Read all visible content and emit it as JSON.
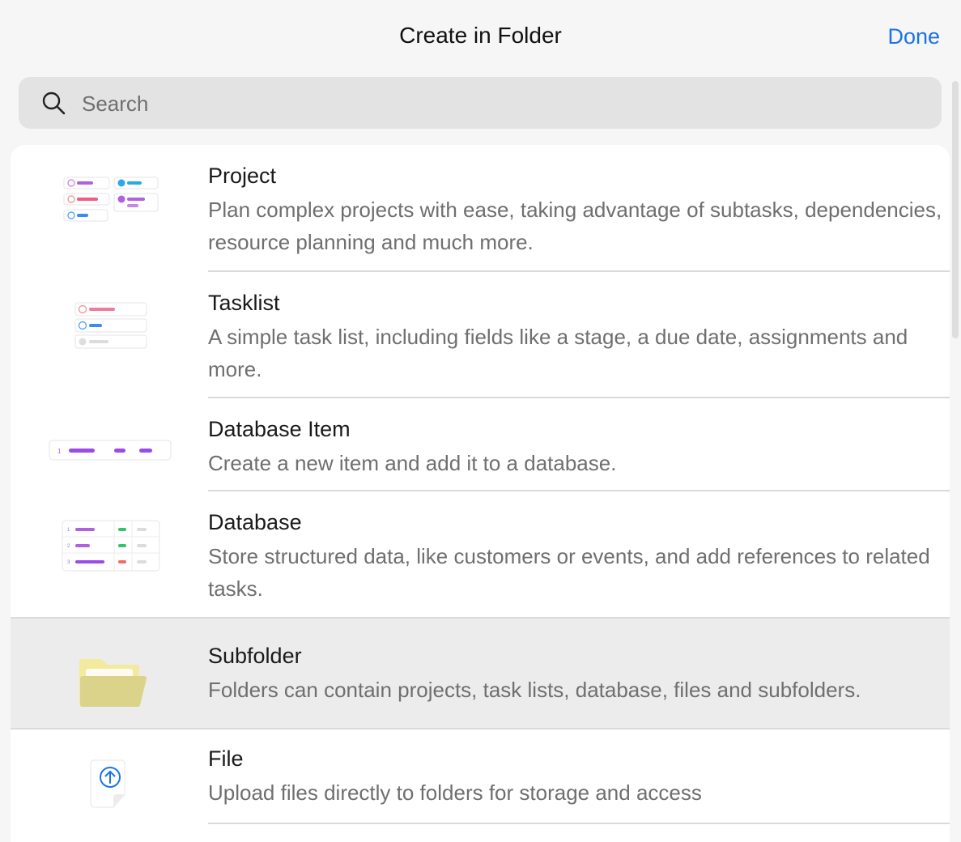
{
  "header": {
    "title": "Create in Folder",
    "done_label": "Done"
  },
  "search": {
    "placeholder": "Search",
    "value": ""
  },
  "items": [
    {
      "name": "Project",
      "description": "Plan complex projects with ease, taking advantage of subtasks, dependencies, resource planning and much more.",
      "icon": "project-icon"
    },
    {
      "name": "Tasklist",
      "description": "A simple task list, including fields like a stage, a due date, assignments and more.",
      "icon": "tasklist-icon"
    },
    {
      "name": "Database Item",
      "description": "Create a new item and add it to a database.",
      "icon": "database-item-icon"
    },
    {
      "name": "Database",
      "description": "Store structured data, like customers or events, and add references to related tasks.",
      "icon": "database-icon"
    },
    {
      "name": "Subfolder",
      "description": "Folders can contain projects, task lists, database, files and subfolders.",
      "icon": "folder-icon",
      "selected": true
    },
    {
      "name": "File",
      "description": "Upload files directly to folders for storage and access",
      "icon": "file-upload-icon"
    }
  ],
  "colors": {
    "accent": "#1a73e8",
    "selected_row": "#ececec",
    "folder": "#dcd38a"
  }
}
